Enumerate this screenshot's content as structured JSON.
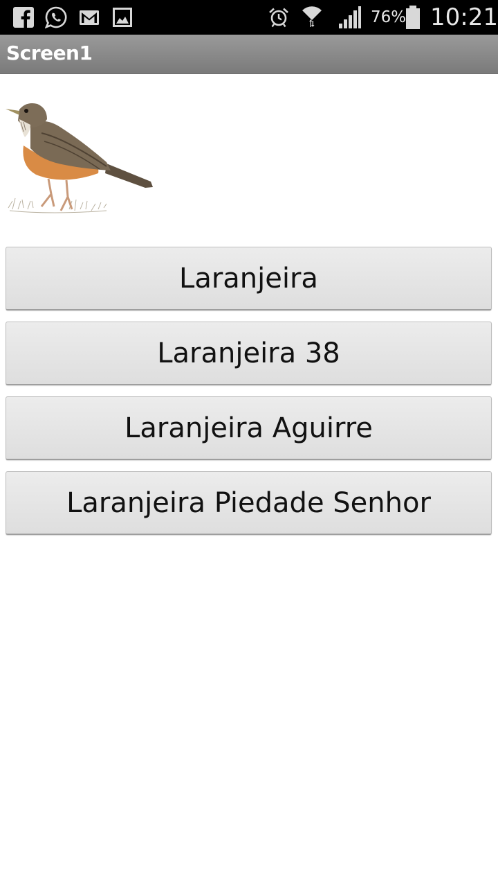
{
  "status_bar": {
    "left_icons": [
      "facebook-icon",
      "whatsapp-icon",
      "gmail-icon",
      "gallery-icon"
    ],
    "right_icons": [
      "alarm-icon",
      "wifi-icon",
      "signal-icon",
      "battery-icon"
    ],
    "battery_percent": "76%",
    "time": "10:21"
  },
  "title_bar": {
    "title": "Screen1"
  },
  "image": {
    "subject": "bird-image"
  },
  "buttons": [
    {
      "label": "Laranjeira"
    },
    {
      "label": "Laranjeira 38"
    },
    {
      "label": "Laranjeira Aguirre"
    },
    {
      "label": "Laranjeira Piedade Senhor"
    }
  ],
  "colors": {
    "status_bar_bg": "#000000",
    "title_bar_bg": "#8a8a8a",
    "button_bg": "#e4e4e4",
    "background": "#ffffff"
  }
}
